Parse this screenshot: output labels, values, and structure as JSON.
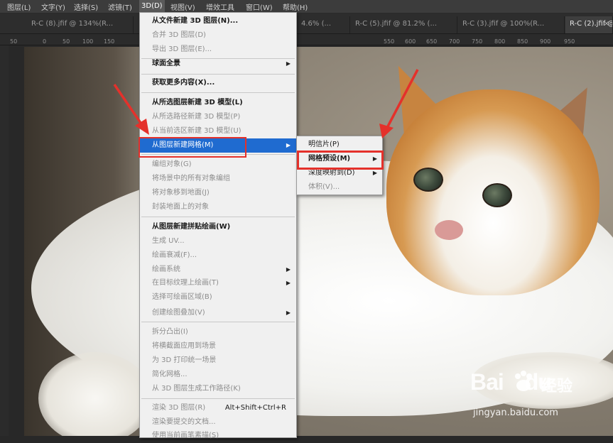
{
  "menubar": {
    "items": [
      "图层(L)",
      "文字(Y)",
      "选择(S)",
      "滤镜(T)",
      "3D(D)",
      "视图(V)",
      "增效工具",
      "窗口(W)",
      "帮助(H)"
    ],
    "active_index": 4
  },
  "tabs": [
    {
      "label": "R-C (8).jfif @ 134%(R..."
    },
    {
      "label": "4.6% (..."
    },
    {
      "label": "R-C (5).jfif @ 81.2% (..."
    },
    {
      "label": "R-C (3).jfif @ 100%(R..."
    },
    {
      "label": "R-C (2).jfif @ 1",
      "active": true,
      "close": "×"
    }
  ],
  "ruler": {
    "ticks": [
      "50",
      "0",
      "50",
      "100",
      "150",
      "550",
      "600",
      "650",
      "700",
      "750",
      "800",
      "850",
      "900",
      "950"
    ]
  },
  "menu_3d": {
    "items": [
      {
        "label": "从文件新建 3D 图层(N)...",
        "state": "bold"
      },
      {
        "label": "合并 3D 图层(D)",
        "state": "disabled"
      },
      {
        "label": "导出 3D 图层(E)...",
        "state": "disabled"
      },
      {
        "label": "球面全景",
        "state": "bold",
        "submenu": true
      },
      {
        "label": "获取更多内容(X)...",
        "state": "bold"
      },
      {
        "label": "从所选图层新建 3D 模型(L)",
        "state": "bold"
      },
      {
        "label": "从所选路径新建 3D 模型(P)",
        "state": "disabled"
      },
      {
        "label": "从当前选区新建 3D 模型(U)",
        "state": "disabled"
      },
      {
        "label": "从图层新建网格(M)",
        "state": "highlighted",
        "submenu": true
      },
      {
        "label": "编组对象(G)",
        "state": "disabled"
      },
      {
        "label": "将场景中的所有对象编组",
        "state": "disabled"
      },
      {
        "label": "将对象移到地面(J)",
        "state": "disabled"
      },
      {
        "label": "封装地面上的对象",
        "state": "disabled"
      },
      {
        "label": "从图层新建拼贴绘画(W)",
        "state": "bold"
      },
      {
        "label": "生成 UV...",
        "state": "disabled"
      },
      {
        "label": "绘画衰减(F)...",
        "state": "disabled"
      },
      {
        "label": "绘画系统",
        "state": "disabled",
        "submenu": true
      },
      {
        "label": "在目标纹理上绘画(T)",
        "state": "disabled",
        "submenu": true
      },
      {
        "label": "选择可绘画区域(B)",
        "state": "disabled"
      },
      {
        "label": "创建绘图叠加(V)",
        "state": "disabled",
        "submenu": true
      },
      {
        "label": "拆分凸出(I)",
        "state": "disabled"
      },
      {
        "label": "将横截面应用到场景",
        "state": "disabled"
      },
      {
        "label": "为 3D 打印统一场景",
        "state": "disabled"
      },
      {
        "label": "简化网格...",
        "state": "disabled"
      },
      {
        "label": "从 3D 图层生成工作路径(K)",
        "state": "disabled"
      },
      {
        "label": "渲染 3D 图层(R)",
        "state": "disabled",
        "shortcut": "Alt+Shift+Ctrl+R"
      },
      {
        "label": "渲染要提交的文档...",
        "state": "disabled"
      },
      {
        "label": "使用当前画笔素描(S)",
        "state": "disabled"
      }
    ]
  },
  "submenu_mesh": {
    "items": [
      {
        "label": "明信片(P)",
        "state": "normal"
      },
      {
        "label": "网格预设(M)",
        "state": "bold",
        "submenu": true
      },
      {
        "label": "深度映射到(D)",
        "state": "normal",
        "submenu": true
      },
      {
        "label": "体积(V)...",
        "state": "disabled"
      }
    ]
  },
  "icons": {
    "submenu_arrow": "▶"
  },
  "annotation_color": "#e4312b",
  "watermark": {
    "logo": "Bai",
    "logo_suffix": "du",
    "cn": "经验",
    "url": "jingyan.baidu.com"
  }
}
